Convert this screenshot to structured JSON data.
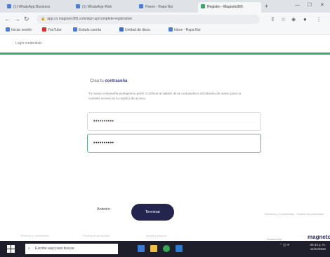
{
  "browser": {
    "tabs": [
      {
        "label": "(1) WhatsApp Business"
      },
      {
        "label": "(1) WhatsApp Web"
      },
      {
        "label": "Pasos - Rapa Nui"
      },
      {
        "label": "Registro - Magneto365"
      }
    ],
    "new_tab_symbol": "+",
    "address": "app.co.magneto365.com/sign-up/complete-registration",
    "bookmarks": [
      {
        "label": "Iniciar sesión",
        "color": "#4a7fd6"
      },
      {
        "label": "YouTube",
        "color": "#e52d27"
      },
      {
        "label": "Estado cuenta",
        "color": "#4a7fd6"
      },
      {
        "label": "Unidad de disco",
        "color": "#3a6ed0"
      },
      {
        "label": "Inbox - Rapa Nui",
        "color": "#4a7fd6"
      }
    ]
  },
  "page": {
    "user_label": "Login credentials",
    "form": {
      "intro_prefix": "Crea tu ",
      "intro_bold": "contraseña",
      "description": "Tu nueva contraseña protegerá tu perfil. Confirma la validez de la contraseña e introdúcela de nuevo para no cometer errores en tu registro de acceso.",
      "password_value": "••••••••••",
      "confirm_value": "••••••••••"
    },
    "buttons": {
      "back": "Anterior",
      "finish": "Terminar"
    },
    "side_note": "Términos y Condiciones · Política de privacidad",
    "footer": [
      "Términos y condiciones",
      "Política de privacidad",
      "Ayuda y soporte"
    ],
    "powered_by": "Powered by",
    "brand": "magneto"
  },
  "taskbar": {
    "search_placeholder": "Escribe aquí para buscar",
    "time": "05:43 p. m.",
    "date": "11/04/2022"
  },
  "colors": {
    "accent_green": "#3aa86b",
    "brand_navy": "#23254f"
  }
}
